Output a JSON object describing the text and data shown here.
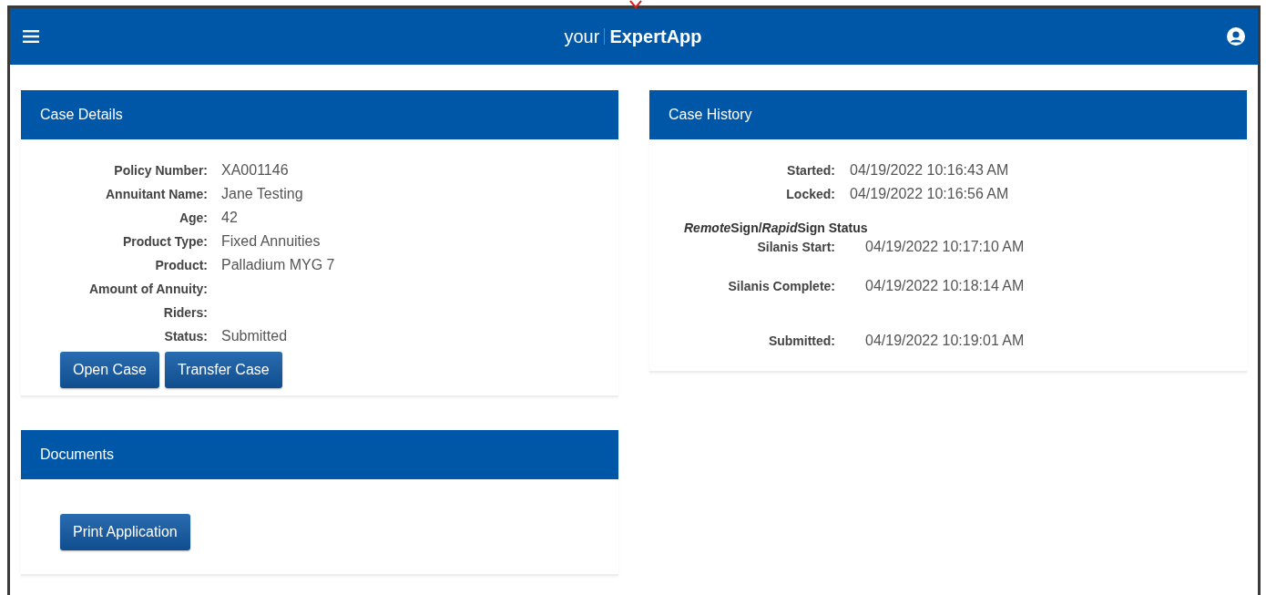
{
  "header": {
    "brand_prefix": "your",
    "brand_name": "ExpertApp"
  },
  "case_details": {
    "title": "Case Details",
    "fields": [
      {
        "label": "Policy Number:",
        "value": "XA001146"
      },
      {
        "label": "Annuitant Name:",
        "value": "Jane Testing"
      },
      {
        "label": "Age:",
        "value": "42"
      },
      {
        "label": "Product Type:",
        "value": "Fixed Annuities"
      },
      {
        "label": "Product:",
        "value": "Palladium MYG 7"
      },
      {
        "label": "Amount of Annuity:"
      },
      {
        "label": "Riders:"
      },
      {
        "label": "Status:",
        "value": "Submitted"
      }
    ],
    "buttons": [
      "Open Case",
      "Transfer Case"
    ]
  },
  "documents": {
    "title": "Documents",
    "buttons": [
      "Print Application"
    ]
  },
  "case_history": {
    "title": "Case History",
    "events": [
      {
        "label": "Started:",
        "value": "04/19/2022 10:16:43 AM"
      },
      {
        "label": "Locked:",
        "value": "04/19/2022 10:16:56 AM"
      }
    ],
    "signing_heading": [
      {
        "text": "Remote",
        "italic": true
      },
      {
        "text": "Sign/",
        "italic": false
      },
      {
        "text": "Rapid",
        "italic": true
      },
      {
        "text": "Sign Status",
        "italic": false
      }
    ],
    "signing_events": [
      {
        "label": "Silanis Start:",
        "value": "04/19/2022 10:17:10 AM"
      },
      {
        "label": "Silanis Complete:",
        "value": "04/19/2022 10:18:14 AM"
      },
      {
        "label": "Submitted:",
        "value": "04/19/2022 10:19:01 AM"
      }
    ]
  }
}
